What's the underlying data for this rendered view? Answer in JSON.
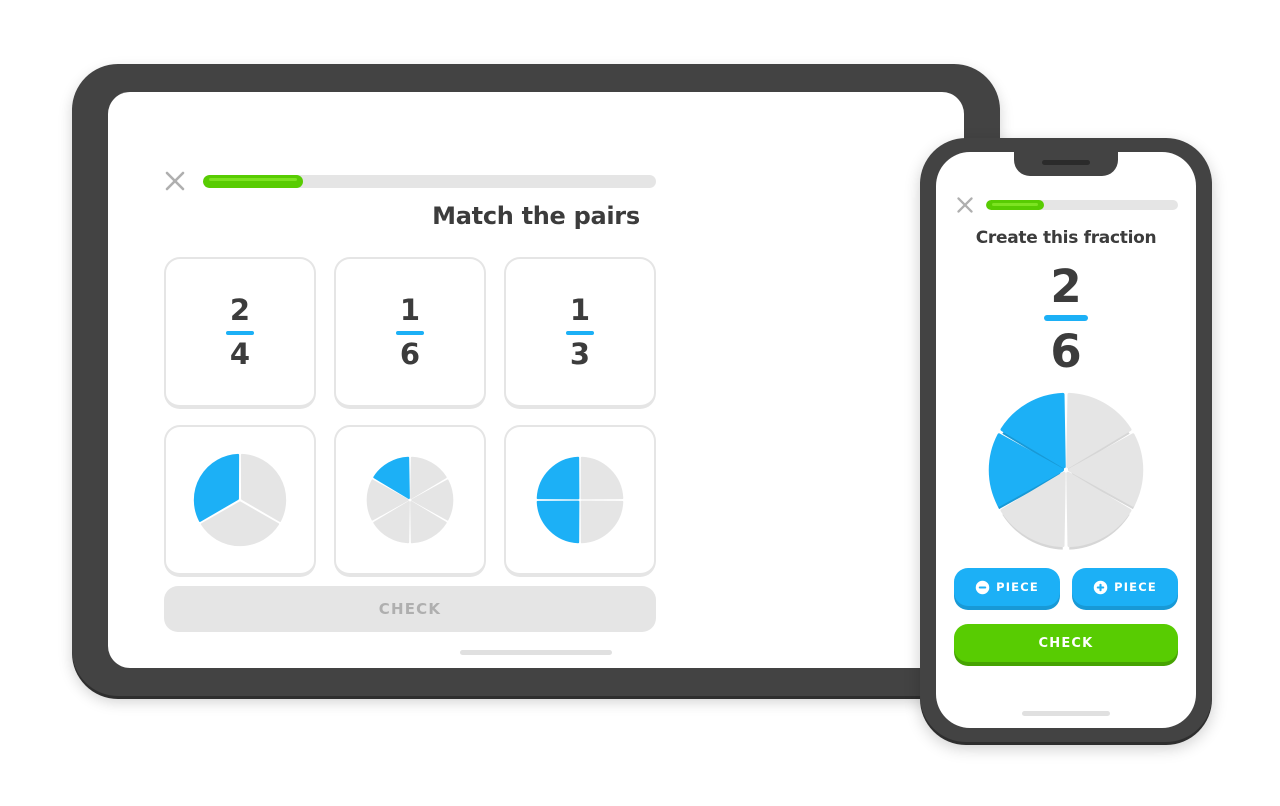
{
  "colors": {
    "blue": "#1cb0f6",
    "blue_shadow": "#1899d6",
    "green": "#58cc02",
    "green_shadow": "#46a302",
    "green_highlight": "#7ce321",
    "gray_track": "#e5e5e5",
    "gray_pie": "#e5e5e5",
    "gray_pie_shadow": "#d6d6d6",
    "text_dark": "#3c3c3c",
    "text_muted": "#afafaf",
    "device_frame": "#434343"
  },
  "tablet": {
    "close_label": "close-icon",
    "progress_percent": 22,
    "title": "Match the pairs",
    "cards": [
      {
        "type": "fraction",
        "numerator": "2",
        "denominator": "4"
      },
      {
        "type": "fraction",
        "numerator": "1",
        "denominator": "6"
      },
      {
        "type": "fraction",
        "numerator": "1",
        "denominator": "3"
      },
      {
        "type": "pie",
        "total": 3,
        "filled": 1
      },
      {
        "type": "pie",
        "total": 6,
        "filled": 1
      },
      {
        "type": "pie",
        "total": 4,
        "filled": 2
      }
    ],
    "check_label": "CHECK",
    "check_enabled": false
  },
  "phone": {
    "close_label": "close-icon",
    "progress_percent": 30,
    "title": "Create this fraction",
    "fraction": {
      "numerator": "2",
      "denominator": "6"
    },
    "pie": {
      "total": 6,
      "filled": 2
    },
    "minus_label": "PIECE",
    "plus_label": "PIECE",
    "check_label": "CHECK",
    "check_enabled": true
  },
  "chart_data": [
    {
      "type": "pie",
      "title": "Match card 4 — one third shaded",
      "categories": [
        "filled",
        "empty"
      ],
      "values": [
        1,
        2
      ],
      "total_slices": 3,
      "filled_slices": 1,
      "fraction": "1/3"
    },
    {
      "type": "pie",
      "title": "Match card 5 — one sixth shaded",
      "categories": [
        "filled",
        "empty"
      ],
      "values": [
        1,
        5
      ],
      "total_slices": 6,
      "filled_slices": 1,
      "fraction": "1/6"
    },
    {
      "type": "pie",
      "title": "Match card 6 — two quarters shaded",
      "categories": [
        "filled",
        "empty"
      ],
      "values": [
        2,
        2
      ],
      "total_slices": 4,
      "filled_slices": 2,
      "fraction": "2/4"
    },
    {
      "type": "pie",
      "title": "Phone fraction builder — two sixths shaded",
      "categories": [
        "filled",
        "empty"
      ],
      "values": [
        2,
        4
      ],
      "total_slices": 6,
      "filled_slices": 2,
      "fraction": "2/6"
    }
  ]
}
